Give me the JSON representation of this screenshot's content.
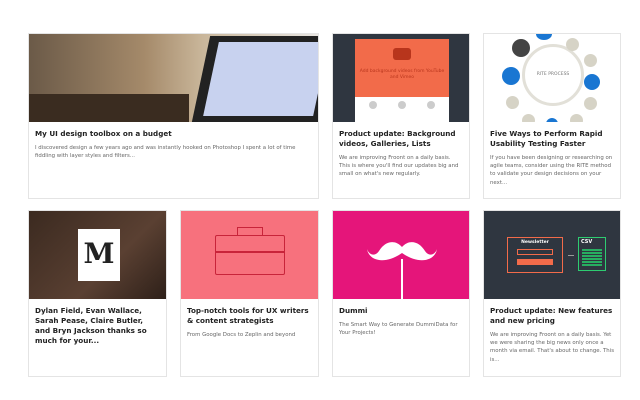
{
  "cards": [
    {
      "title": "My UI design toolbox on a budget",
      "desc": "I discovered design a few years ago and was instantly hooked on Photoshop I spent a lot of time fiddling with layer styles and filters..."
    },
    {
      "title": "Product update: Background videos, Galleries, Lists",
      "desc": "We are improving Froont on a daily basis. This is where you'll find our updates big and small on what's new regularly.",
      "image_text": "Add background videos from YouTube and Vimeo"
    },
    {
      "title": "Five Ways to Perform Rapid Usability Testing Faster",
      "desc": "If you have been designing or researching on agile teams, consider using the RITE method to validate your design decisions on your next...",
      "image_text": "RITE PROCESS"
    },
    {
      "title": "Dylan Field, Evan Wallace, Sarah Pease, Claire Butler, and Bryn Jackson thanks so much for your...",
      "desc": "",
      "image_text": "M"
    },
    {
      "title": "Top-notch tools for UX writers & content strategists",
      "desc": "From Google Docs to Zeplin and beyond"
    },
    {
      "title": "Dummi",
      "desc": "The Smart Way to Generate DummiData for Your Projects!"
    },
    {
      "title": "Product update: New features and new pricing",
      "desc": "We are improving Froont on a daily basis. Yet we were sharing the big news only once a month via email. That's about to change. This is...",
      "image_text": "Newsletter",
      "image_text2": "CSV"
    }
  ],
  "colors": {
    "orange": "#f26b4a",
    "pink": "#e5157a",
    "coral": "#f7717d",
    "dark": "#2f3640"
  }
}
